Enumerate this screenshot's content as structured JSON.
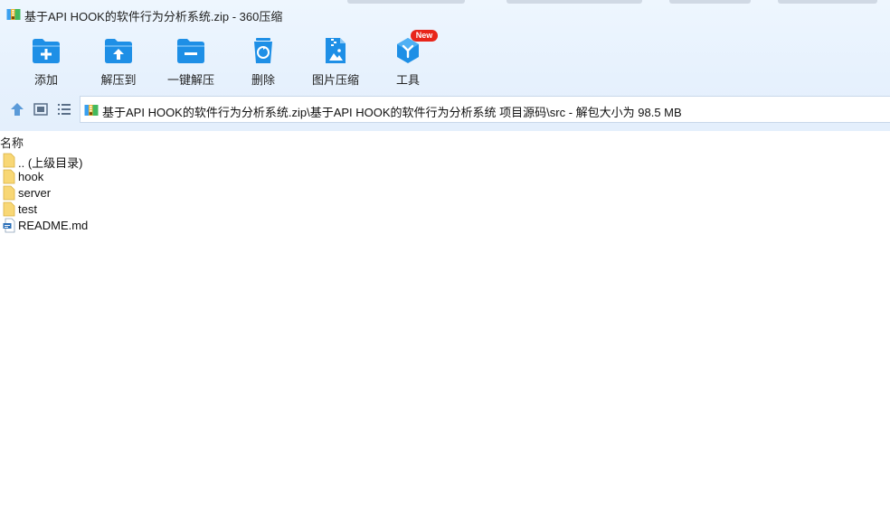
{
  "window": {
    "title": "基于API HOOK的软件行为分析系统.zip - 360压缩",
    "icon": "zip-archive-icon"
  },
  "toolbar": {
    "items": [
      {
        "label": "添加",
        "icon": "add-folder-icon"
      },
      {
        "label": "解压到",
        "icon": "extract-to-icon"
      },
      {
        "label": "一键解压",
        "icon": "one-click-extract-icon"
      },
      {
        "label": "删除",
        "icon": "recycle-bin-icon"
      },
      {
        "label": "图片压缩",
        "icon": "image-compress-icon"
      },
      {
        "label": "工具",
        "icon": "tools-cube-icon",
        "badge": "New"
      }
    ]
  },
  "nav": {
    "up_icon": "up-arrow-icon",
    "view_icon": "thumbnail-view-icon",
    "list_icon": "list-view-icon",
    "address_path": "基于API HOOK的软件行为分析系统.zip\\基于API HOOK的软件行为分析系统 项目源码\\src - 解包大小为 98.5 MB"
  },
  "list": {
    "column_name": "名称",
    "items": [
      {
        "name": ".. (上级目录)",
        "type": "folder"
      },
      {
        "name": "hook",
        "type": "folder"
      },
      {
        "name": "server",
        "type": "folder"
      },
      {
        "name": "test",
        "type": "folder"
      },
      {
        "name": "README.md",
        "type": "file"
      }
    ]
  },
  "colors": {
    "accent": "#1e8fe6",
    "band": "#e6f1fd",
    "folder": "#f8d775",
    "badge": "#e8251a"
  }
}
